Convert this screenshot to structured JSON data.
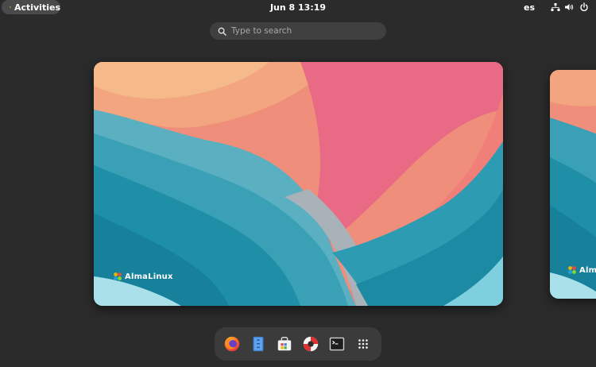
{
  "topbar": {
    "activities_label": "Activities",
    "clock": "Jun 8  13:19",
    "keyboard_layout": "es",
    "tray_icons": [
      "network-icon",
      "volume-icon",
      "power-icon"
    ]
  },
  "search": {
    "placeholder": "Type to search"
  },
  "workspaces": [
    {
      "brand": "AlmaLinux",
      "active": true
    },
    {
      "brand": "Alma",
      "active": false
    }
  ],
  "dash": {
    "apps": [
      "firefox-icon",
      "files-icon",
      "software-icon",
      "help-icon",
      "terminal-icon",
      "app-grid-icon"
    ]
  },
  "colors": {
    "background": "#2b2b2b",
    "panel_pill": "#4a4a4a",
    "search_bg": "#3f3f3f",
    "dash_bg": "#3b3b3b"
  }
}
